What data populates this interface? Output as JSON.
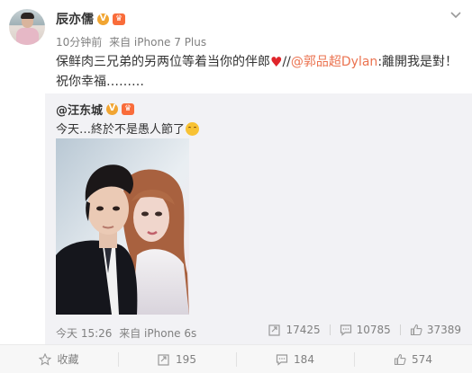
{
  "post": {
    "author": "辰亦儒",
    "verified_badge": "V",
    "member_badge": "♛",
    "time": "10分钟前",
    "source": "来自 iPhone 7 Plus",
    "text_before": "保鲜肉三兄弟的另两位等着当你的伴郎",
    "text_sep": "//",
    "mention": "@郭品超Dylan",
    "text_after": ":離開我是對！祝你幸福………"
  },
  "repost": {
    "author": "@汪东城",
    "verified_badge": "V",
    "member_badge": "♛",
    "text": "今天…終於不是愚人節了",
    "time": "今天 15:26",
    "source": "来自 iPhone 6s",
    "reposts": "17425",
    "comments": "10785",
    "likes": "37389"
  },
  "actions": {
    "favorite": "收藏",
    "forward": "195",
    "comment": "184",
    "like": "574"
  },
  "icons": {
    "chevron": "chevron-down-icon",
    "repost": "repost-icon",
    "comment": "comment-icon",
    "like": "like-icon",
    "favorite": "star-icon"
  },
  "colors": {
    "link": "#eb7350",
    "muted": "#808080",
    "repost_bg": "#f2f2f5",
    "heart": "#e0252b",
    "badge": "#f1a532"
  }
}
